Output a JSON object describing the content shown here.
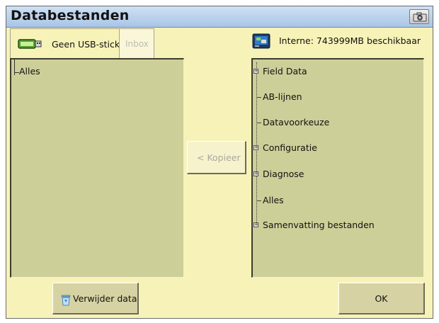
{
  "window": {
    "title": "Databestanden"
  },
  "tabs": [
    {
      "label": "Geen USB-stick",
      "icon": "usb-stick-icon",
      "active": true
    },
    {
      "label": "Inbox",
      "active": false,
      "disabled": true
    }
  ],
  "storage": {
    "label": "Interne: 743999MB beschikbaar",
    "icon": "hard-drive-icon"
  },
  "left_tree": {
    "items": [
      {
        "label": "Alles"
      }
    ]
  },
  "right_tree": {
    "items": [
      {
        "label": "Field Data",
        "expandable": true
      },
      {
        "label": "AB-lijnen",
        "expandable": false
      },
      {
        "label": "Datavoorkeuze",
        "expandable": false
      },
      {
        "label": "Configuratie",
        "expandable": true
      },
      {
        "label": "Diagnose",
        "expandable": true
      },
      {
        "label": "Alles",
        "expandable": false
      },
      {
        "label": "Samenvatting bestanden",
        "expandable": true
      }
    ]
  },
  "buttons": {
    "copy": "< Kopieer",
    "delete": "Verwijder data",
    "ok": "OK"
  },
  "colors": {
    "background": "#f7f3b8",
    "panel": "#cdcf98",
    "titlebar": "#b9d1ec"
  }
}
